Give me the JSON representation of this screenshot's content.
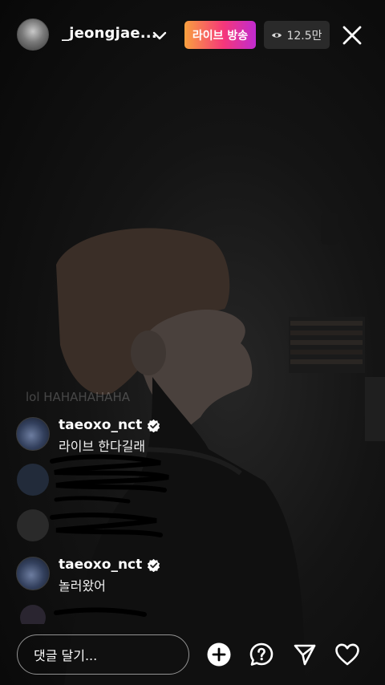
{
  "header": {
    "username": "_jeongjae...",
    "live_badge": "라이브 방송",
    "viewer_count": "12.5만",
    "avatar_icon": "profile-avatar",
    "dropdown_icon": "chevron-down-icon",
    "close_icon": "close-icon",
    "viewer_icon": "eye-icon"
  },
  "comments": {
    "faded_text": "lol HAHAHAHAHA",
    "items": [
      {
        "username": "taeoxo_nct",
        "text": "라이브 한다길래",
        "verified": true
      },
      {
        "username": "taeoxo_nct",
        "text": "놀러왔어",
        "verified": true
      }
    ]
  },
  "bottom_bar": {
    "comment_placeholder": "댓글 달기...",
    "icons": [
      "add-icon",
      "question-icon",
      "send-icon",
      "heart-icon"
    ]
  },
  "colors": {
    "live_gradient": [
      "#f9a03f",
      "#f5377a",
      "#c12bd0"
    ],
    "background": "#000000"
  }
}
